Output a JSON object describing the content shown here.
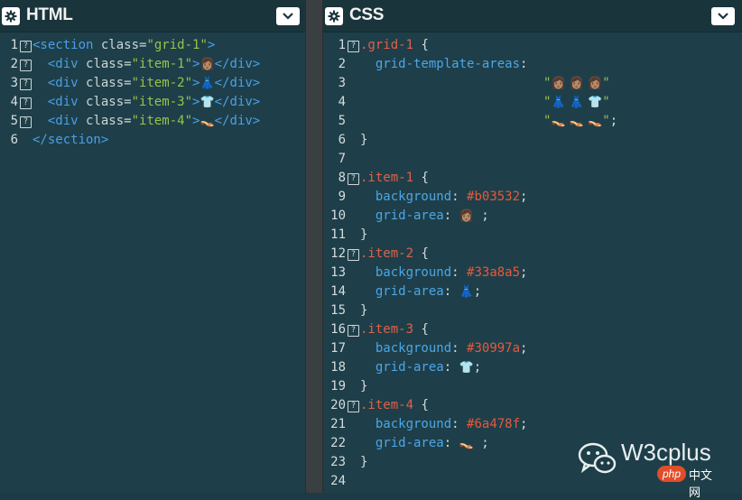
{
  "html_panel": {
    "title": "HTML",
    "gear_icon": "gear-icon",
    "collapse_icon": "chevron-down-icon",
    "lines": [
      {
        "n": "1",
        "fold": true,
        "html": "<span class=\"tag\">&lt;section</span> <span class=\"attr\">class=</span><span class=\"str\">\"grid-1\"</span><span class=\"tag\">&gt;</span>"
      },
      {
        "n": "2",
        "fold": true,
        "html": "  <span class=\"tag\">&lt;div</span> <span class=\"attr\">class=</span><span class=\"str\">\"item-1\"</span><span class=\"tag\">&gt;</span><span class=\"emoji\">👩🏽</span><span class=\"tag\">&lt;/div&gt;</span>"
      },
      {
        "n": "3",
        "fold": true,
        "html": "  <span class=\"tag\">&lt;div</span> <span class=\"attr\">class=</span><span class=\"str\">\"item-2\"</span><span class=\"tag\">&gt;</span><span class=\"emoji\">👗</span><span class=\"tag\">&lt;/div&gt;</span>"
      },
      {
        "n": "4",
        "fold": true,
        "html": "  <span class=\"tag\">&lt;div</span> <span class=\"attr\">class=</span><span class=\"str\">\"item-3\"</span><span class=\"tag\">&gt;</span><span class=\"emoji\">👕</span><span class=\"tag\">&lt;/div&gt;</span>"
      },
      {
        "n": "5",
        "fold": true,
        "html": "  <span class=\"tag\">&lt;div</span> <span class=\"attr\">class=</span><span class=\"str\">\"item-4\"</span><span class=\"tag\">&gt;</span><span class=\"emoji\">👡</span><span class=\"tag\">&lt;/div&gt;</span>"
      },
      {
        "n": "6",
        "fold": false,
        "html": "<span class=\"tag\">&lt;/section&gt;</span>"
      }
    ]
  },
  "css_panel": {
    "title": "CSS",
    "gear_icon": "gear-icon",
    "collapse_icon": "chevron-down-icon",
    "lines": [
      {
        "n": "1",
        "fold": true,
        "html": "<span class=\"sel\">.grid-1</span> <span class=\"punc\">{</span>"
      },
      {
        "n": "2",
        "fold": false,
        "html": "  <span class=\"prop\">grid-template-areas</span><span class=\"punc\">:</span>"
      },
      {
        "n": "3",
        "fold": false,
        "html": "",
        "area": "<span class=\"q\">\"</span><span class=\"emoji\">👩🏽 👩🏽 👩🏽</span><span class=\"q\">\"</span>"
      },
      {
        "n": "4",
        "fold": false,
        "html": "",
        "area": "<span class=\"q\">\"</span><span class=\"emoji\">👗 👗 👕</span><span class=\"q\">\"</span>"
      },
      {
        "n": "5",
        "fold": false,
        "html": "",
        "area": "<span class=\"q\">\"</span><span class=\"emoji\">👡 👡 👡</span><span class=\"q\">\"</span><span class=\"punc\">;</span>"
      },
      {
        "n": "6",
        "fold": false,
        "html": "<span class=\"punc\">}</span>"
      },
      {
        "n": "7",
        "fold": false,
        "html": ""
      },
      {
        "n": "8",
        "fold": true,
        "html": "<span class=\"sel\">.item-1</span> <span class=\"punc\">{</span>"
      },
      {
        "n": "9",
        "fold": false,
        "html": "  <span class=\"prop\">background</span><span class=\"punc\">:</span> <span class=\"hex\">#b03532</span><span class=\"punc\">;</span>"
      },
      {
        "n": "10",
        "fold": false,
        "html": "  <span class=\"prop\">grid-area</span><span class=\"punc\">:</span> <span class=\"emoji\">👩🏽</span> <span class=\"punc\">;</span>"
      },
      {
        "n": "11",
        "fold": false,
        "html": "<span class=\"punc\">}</span>"
      },
      {
        "n": "12",
        "fold": true,
        "html": "<span class=\"sel\">.item-2</span> <span class=\"punc\">{</span>"
      },
      {
        "n": "13",
        "fold": false,
        "html": "  <span class=\"prop\">background</span><span class=\"punc\">:</span> <span class=\"hex\">#33a8a5</span><span class=\"punc\">;</span>"
      },
      {
        "n": "14",
        "fold": false,
        "html": "  <span class=\"prop\">grid-area</span><span class=\"punc\">:</span> <span class=\"emoji\">👗</span><span class=\"punc\">;</span>"
      },
      {
        "n": "15",
        "fold": false,
        "html": "<span class=\"punc\">}</span>"
      },
      {
        "n": "16",
        "fold": true,
        "html": "<span class=\"sel\">.item-3</span> <span class=\"punc\">{</span>"
      },
      {
        "n": "17",
        "fold": false,
        "html": "  <span class=\"prop\">background</span><span class=\"punc\">:</span> <span class=\"hex\">#30997a</span><span class=\"punc\">;</span>"
      },
      {
        "n": "18",
        "fold": false,
        "html": "  <span class=\"prop\">grid-area</span><span class=\"punc\">:</span> <span class=\"emoji\">👕</span><span class=\"punc\">;</span>"
      },
      {
        "n": "19",
        "fold": false,
        "html": "<span class=\"punc\">}</span>"
      },
      {
        "n": "20",
        "fold": true,
        "html": "<span class=\"sel\">.item-4</span> <span class=\"punc\">{</span>"
      },
      {
        "n": "21",
        "fold": false,
        "html": "  <span class=\"prop\">background</span><span class=\"punc\">:</span> <span class=\"hex\">#6a478f</span><span class=\"punc\">;</span>"
      },
      {
        "n": "22",
        "fold": false,
        "html": "  <span class=\"prop\">grid-area</span><span class=\"punc\">:</span> <span class=\"emoji\">👡</span> <span class=\"punc\">;</span>"
      },
      {
        "n": "23",
        "fold": false,
        "html": "<span class=\"punc\">}</span>"
      },
      {
        "n": "24",
        "fold": false,
        "html": ""
      }
    ]
  },
  "watermark": {
    "brand": "W3cplus",
    "badge": "php",
    "badge_suffix": "中文网",
    "icon": "wechat-icon"
  },
  "colors": {
    "panel_bg": "#1e3f49",
    "header_bg": "#1a343c",
    "divider": "#3a3f42",
    "tag": "#4c9ee6",
    "string": "#97c24b",
    "selector": "#e0604a",
    "property": "#4ca6e8",
    "hex_value": "#e8583c"
  }
}
